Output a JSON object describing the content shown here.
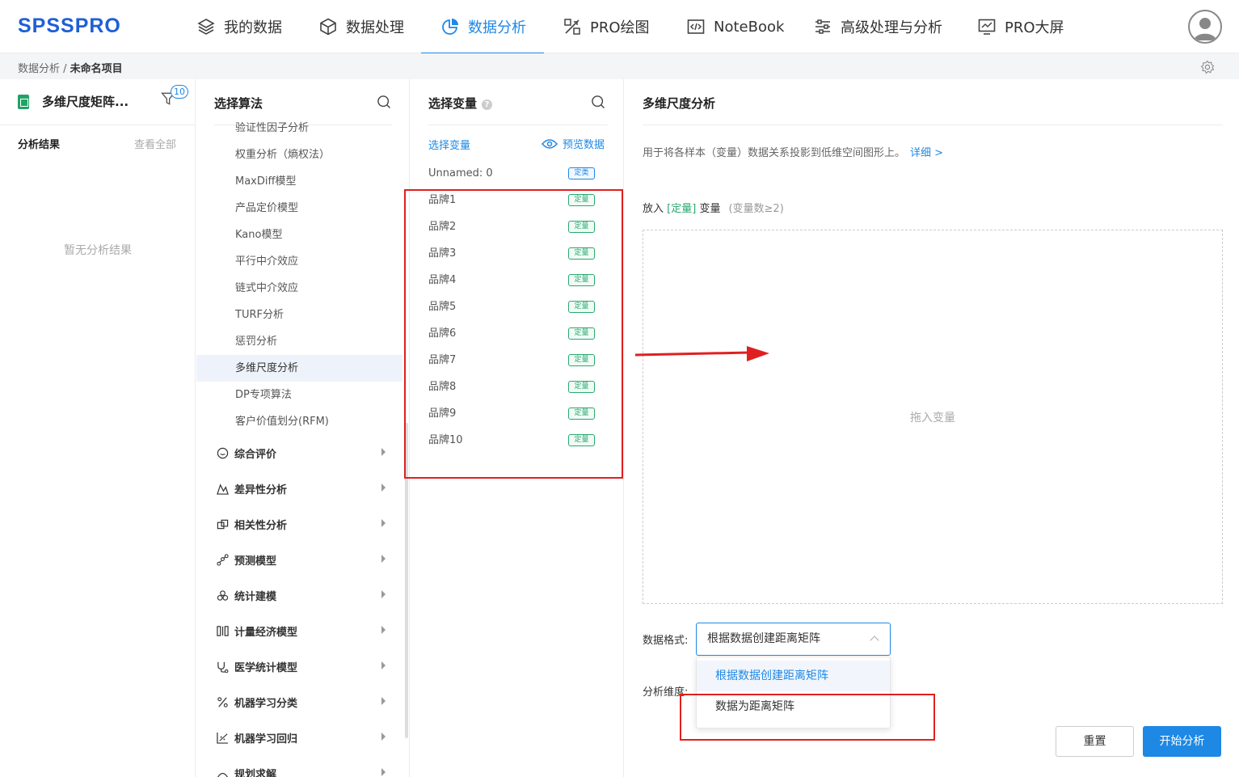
{
  "app": {
    "logo": "SPSSPRO"
  },
  "nav": [
    {
      "label": "我的数据",
      "icon": "layers-icon"
    },
    {
      "label": "数据处理",
      "icon": "cube-icon"
    },
    {
      "label": "数据分析",
      "icon": "pie-chart-icon",
      "active": true
    },
    {
      "label": "PRO绘图",
      "icon": "drawing-icon"
    },
    {
      "label": "NoteBook",
      "icon": "code-window-icon"
    },
    {
      "label": "高级处理与分析",
      "icon": "sliders-icon"
    },
    {
      "label": "PRO大屏",
      "icon": "monitor-chart-icon"
    }
  ],
  "breadcrumb": {
    "parent": "数据分析",
    "sep": " / ",
    "current": "未命名项目"
  },
  "left": {
    "project_name": "多维尺度矩阵...",
    "filter_badge": "10",
    "results_title": "分析结果",
    "view_all": "查看全部",
    "empty": "暂无分析结果"
  },
  "algorithms": {
    "title": "选择算法",
    "items": [
      "验证性因子分析",
      "权重分析（熵权法）",
      "MaxDiff模型",
      "产品定价模型",
      "Kano模型",
      "平行中介效应",
      "链式中介效应",
      "TURF分析",
      "惩罚分析",
      "多维尺度分析",
      "DP专项算法",
      "客户价值划分(RFM)"
    ],
    "selected": "多维尺度分析",
    "categories": [
      "综合评价",
      "差异性分析",
      "相关性分析",
      "预测模型",
      "统计建模",
      "计量经济模型",
      "医学统计模型",
      "机器学习分类",
      "机器学习回归",
      "规划求解"
    ]
  },
  "variables": {
    "title": "选择变量",
    "help": "?",
    "select_link": "选择变量",
    "preview": "预览数据",
    "items": [
      {
        "name": "Unnamed: 0",
        "type": "定类"
      },
      {
        "name": "品牌1",
        "type": "定量"
      },
      {
        "name": "品牌2",
        "type": "定量"
      },
      {
        "name": "品牌3",
        "type": "定量"
      },
      {
        "name": "品牌4",
        "type": "定量"
      },
      {
        "name": "品牌5",
        "type": "定量"
      },
      {
        "name": "品牌6",
        "type": "定量"
      },
      {
        "name": "品牌7",
        "type": "定量"
      },
      {
        "name": "品牌8",
        "type": "定量"
      },
      {
        "name": "品牌9",
        "type": "定量"
      },
      {
        "name": "品牌10",
        "type": "定量"
      }
    ]
  },
  "config": {
    "title": "多维尺度分析",
    "description": "用于将各样本（变量）数据关系投影到低维空间图形上。",
    "detail_link": "详细 >",
    "put_prefix": "放入",
    "put_type": "[定量]",
    "put_suffix": "变量",
    "put_hint": "(变量数≥2)",
    "drop_text": "拖入变量",
    "format_label": "数据格式:",
    "format_value": "根据数据创建距离矩阵",
    "format_options": [
      "根据数据创建距离矩阵",
      "数据为距离矩阵"
    ],
    "dimension_label": "分析维度:",
    "reset": "重置",
    "start": "开始分析"
  },
  "colors": {
    "accent": "#1e88e5",
    "quant_tag": "#2aa86f",
    "annotation": "#e02020"
  }
}
